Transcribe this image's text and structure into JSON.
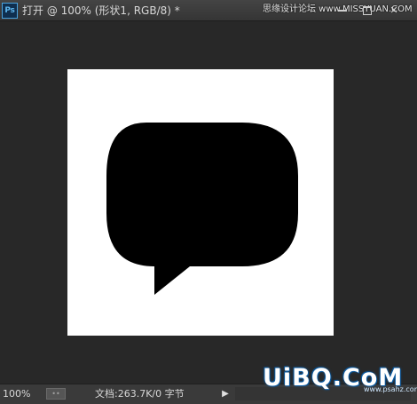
{
  "window": {
    "app_badge": "Ps",
    "title": "打开 @ 100% (形状1, RGB/8) *",
    "watermark_top": "思缘设计论坛 www.MISSYUAN.COM"
  },
  "canvas": {
    "background": "#ffffff",
    "shape_color": "#000000",
    "shape": "speech-bubble"
  },
  "statusbar": {
    "zoom": "100%",
    "doc_info": "文档:263.7K/0 字节",
    "arrow_icon": "play-right-icon"
  },
  "watermark": {
    "logo": "UiBQ.CoM",
    "url": "www.psahz.com"
  },
  "colors": {
    "workspace": "#282828",
    "titlebar": "#3b3b3b",
    "statusbar": "#3a3a3a",
    "text": "#d8d8d8"
  }
}
